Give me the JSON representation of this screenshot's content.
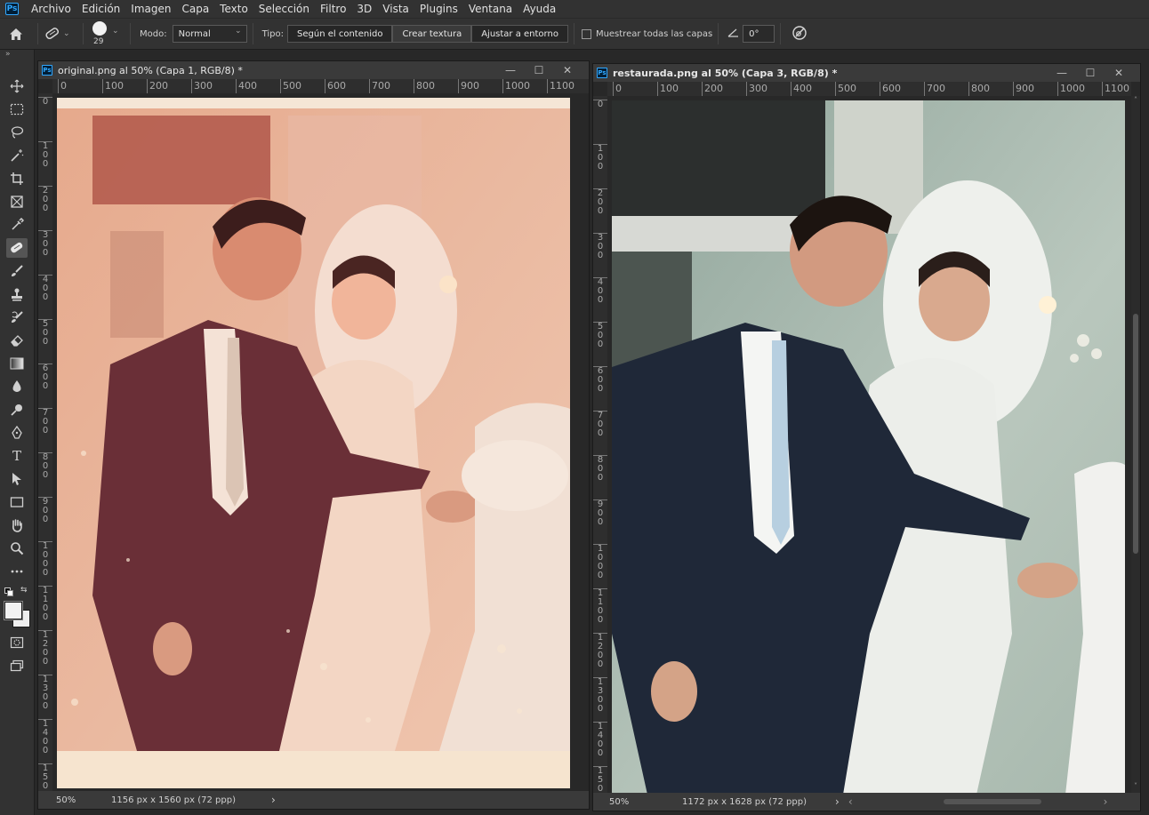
{
  "app": {
    "logo": "Ps"
  },
  "menu": [
    "Archivo",
    "Edición",
    "Imagen",
    "Capa",
    "Texto",
    "Selección",
    "Filtro",
    "3D",
    "Vista",
    "Plugins",
    "Ventana",
    "Ayuda"
  ],
  "options": {
    "brush_size": "29",
    "mode_label": "Modo:",
    "mode_value": "Normal",
    "type_label": "Tipo:",
    "type_options": [
      "Según el contenido",
      "Crear textura",
      "Ajustar a entorno"
    ],
    "sample_all_layers": "Muestrear todas las capas",
    "angle_value": "0°"
  },
  "doc_left": {
    "title": "original.png al 50% (Capa 1, RGB/8) *",
    "ruler_h": [
      "0",
      "100",
      "200",
      "300",
      "400",
      "500",
      "600",
      "700",
      "800",
      "900",
      "1000",
      "1100"
    ],
    "ruler_v": [
      "0",
      "1\n0\n0",
      "2\n0\n0",
      "3\n0\n0",
      "4\n0\n0",
      "5\n0\n0",
      "6\n0\n0",
      "7\n0\n0",
      "8\n0\n0",
      "9\n0\n0",
      "1\n0\n0\n0",
      "1\n1\n0\n0",
      "1\n2\n0\n0",
      "1\n3\n0\n0",
      "1\n4\n0\n0",
      "1\n5\n0\n0"
    ],
    "zoom": "50%",
    "doc_info": "1156 px x 1560 px (72 ppp)"
  },
  "doc_right": {
    "title": "restaurada.png al 50% (Capa 3, RGB/8) *",
    "ruler_h": [
      "0",
      "100",
      "200",
      "300",
      "400",
      "500",
      "600",
      "700",
      "800",
      "900",
      "1000",
      "1100"
    ],
    "ruler_v": [
      "0",
      "1\n0\n0",
      "2\n0\n0",
      "3\n0\n0",
      "4\n0\n0",
      "5\n0\n0",
      "6\n0\n0",
      "7\n0\n0",
      "8\n0\n0",
      "9\n0\n0",
      "1\n0\n0\n0",
      "1\n1\n0\n0",
      "1\n2\n0\n0",
      "1\n3\n0\n0",
      "1\n4\n0\n0",
      "1\n5\n0\n0"
    ],
    "zoom": "50%",
    "doc_info": "1172 px x 1628 px (72 ppp)"
  },
  "colors": {
    "accent": "#31a8ff",
    "panel": "#323232",
    "canvas_bg": "#282828"
  },
  "icons": [
    "home-icon",
    "healing-brush-icon",
    "brush-tip-icon",
    "target-icon"
  ]
}
